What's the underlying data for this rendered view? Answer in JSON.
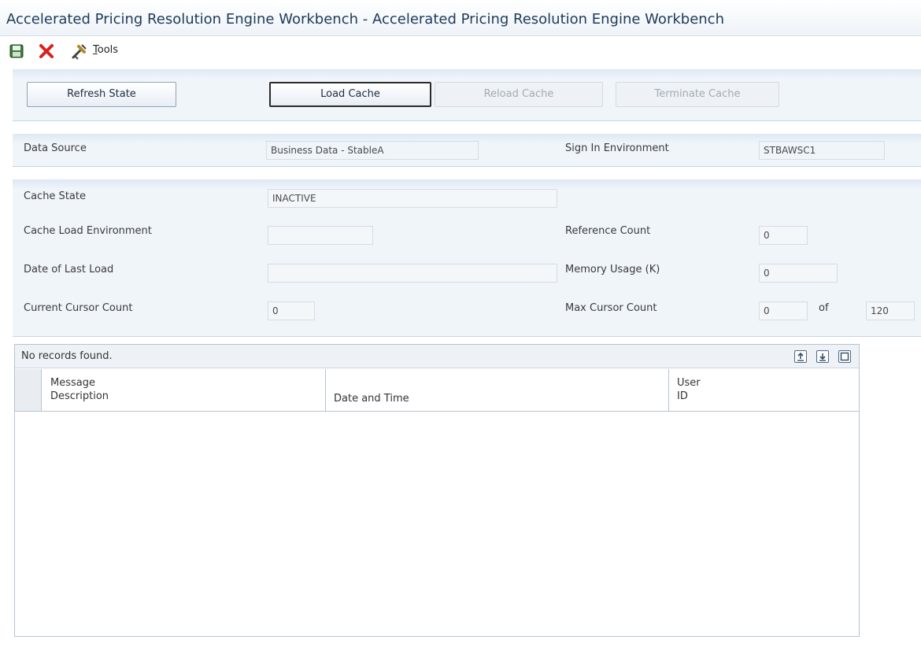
{
  "window": {
    "title": "Accelerated Pricing Resolution Engine Workbench - Accelerated Pricing Resolution Engine Workbench"
  },
  "toolbar": {
    "save_icon": "save-icon",
    "cancel_icon": "close-icon",
    "tools_icon": "tools-icon",
    "tools_label_first": "T",
    "tools_label_rest": "ools"
  },
  "actions": {
    "refresh_state": "Refresh State",
    "load_cache": "Load Cache",
    "reload_cache": "Reload Cache",
    "terminate_cache": "Terminate Cache"
  },
  "data_source": {
    "label": "Data Source",
    "value": "Business Data - StableA",
    "sign_in_env_label": "Sign In Environment",
    "sign_in_env_value": "STBAWSC1"
  },
  "cache": {
    "state_label": "Cache State",
    "state_value": "INACTIVE",
    "load_env_label": "Cache Load Environment",
    "load_env_value": "",
    "last_load_label": "Date of Last Load",
    "last_load_value": "",
    "cursor_count_label": "Current Cursor Count",
    "cursor_count_value": "0",
    "ref_count_label": "Reference Count",
    "ref_count_value": "0",
    "memory_label": "Memory Usage (K)",
    "memory_value": "0",
    "max_cursor_label": "Max Cursor Count",
    "max_cursor_value": "0",
    "of_label": "of",
    "max_cursor_total": "120"
  },
  "grid": {
    "status": "No records found.",
    "columns": [
      {
        "line1": "Message",
        "line2": "Description"
      },
      {
        "line1": "",
        "line2": "Date and Time"
      },
      {
        "line1": "User",
        "line2": "ID"
      }
    ],
    "rows": []
  },
  "colors": {
    "title_text": "#1e3a5a",
    "panel_bg": "#f0f5fa",
    "cancel_red": "#d9211c",
    "save_green": "#3d7a3d"
  }
}
